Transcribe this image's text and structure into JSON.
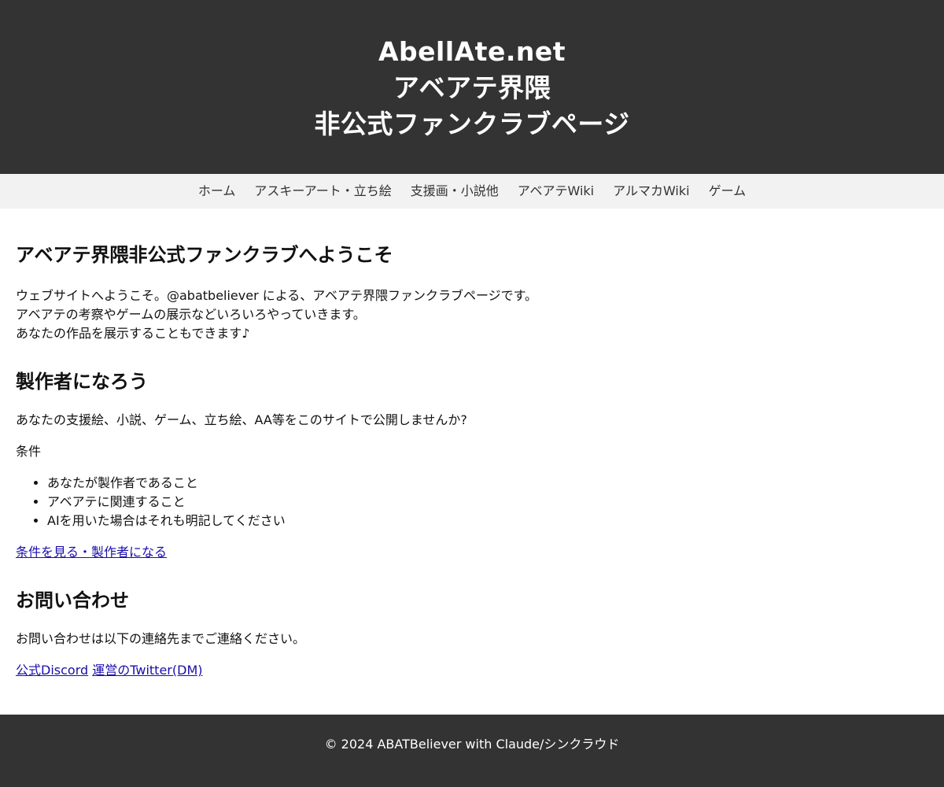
{
  "header": {
    "title_line1": "AbellAte.net",
    "title_line2": "アベアテ界隈",
    "title_line3": "非公式ファンクラブページ"
  },
  "nav": {
    "items": [
      {
        "label": "ホーム"
      },
      {
        "label": "アスキーアート・立ち絵"
      },
      {
        "label": "支援画・小説他"
      },
      {
        "label": "アベアテWiki"
      },
      {
        "label": "アルマカWiki"
      },
      {
        "label": "ゲーム"
      }
    ]
  },
  "welcome": {
    "heading": "アベアテ界隈非公式ファンクラブへようこそ",
    "line1": "ウェブサイトへようこそ。@abatbeliever による、アベアテ界隈ファンクラブページです。",
    "line2": "アベアテの考察やゲームの展示などいろいろやっていきます。",
    "line3": "あなたの作品を展示することもできます♪"
  },
  "creator": {
    "heading": "製作者になろう",
    "intro": "あなたの支援絵、小説、ゲーム、立ち絵、AA等をこのサイトで公開しませんか?",
    "conditions_label": "条件",
    "conditions": [
      "あなたが製作者であること",
      "アベアテに関連すること",
      "AIを用いた場合はそれも明記してください"
    ],
    "link_label": "条件を見る・製作者になる"
  },
  "contact": {
    "heading": "お問い合わせ",
    "text": "お問い合わせは以下の連絡先までご連絡ください。",
    "discord_label": "公式Discord",
    "twitter_label": "運営のTwitter(DM)"
  },
  "footer": {
    "text": "© 2024 ABATBeliever with Claude/シンクラウド"
  },
  "colors": {
    "header_bg": "#333333",
    "nav_bg": "#f2f2f2",
    "link": "#1a0dab"
  }
}
